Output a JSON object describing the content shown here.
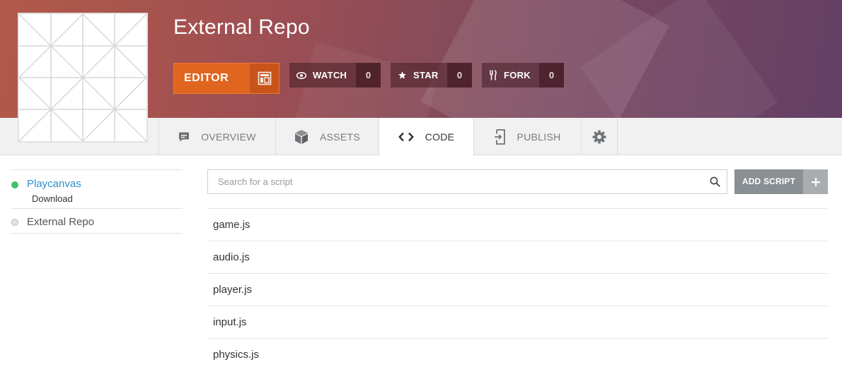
{
  "header": {
    "repo_title": "External Repo",
    "editor_label": "EDITOR",
    "watch": {
      "label": "WATCH",
      "count": "0"
    },
    "star": {
      "label": "STAR",
      "count": "0"
    },
    "fork": {
      "label": "FORK",
      "count": "0"
    }
  },
  "tabs": [
    {
      "label": "OVERVIEW",
      "icon": "chat-bubble-icon"
    },
    {
      "label": "ASSETS",
      "icon": "cube-icon"
    },
    {
      "label": "CODE",
      "icon": "code-brackets-icon",
      "active": true
    },
    {
      "label": "PUBLISH",
      "icon": "publish-icon"
    },
    {
      "label": "",
      "icon": "gear-icon"
    }
  ],
  "sidebar": {
    "items": [
      {
        "label": "Playcanvas",
        "sub": "Download",
        "status": "active"
      },
      {
        "label": "External Repo",
        "status": "inactive"
      }
    ]
  },
  "search": {
    "placeholder": "Search for a script",
    "value": ""
  },
  "add_script_label": "ADD SCRIPT",
  "scripts": [
    "game.js",
    "audio.js",
    "player.js",
    "input.js",
    "physics.js"
  ],
  "colors": {
    "accent_orange": "#e0651f",
    "link_blue": "#2f8fd0",
    "status_green": "#3fc26a"
  }
}
